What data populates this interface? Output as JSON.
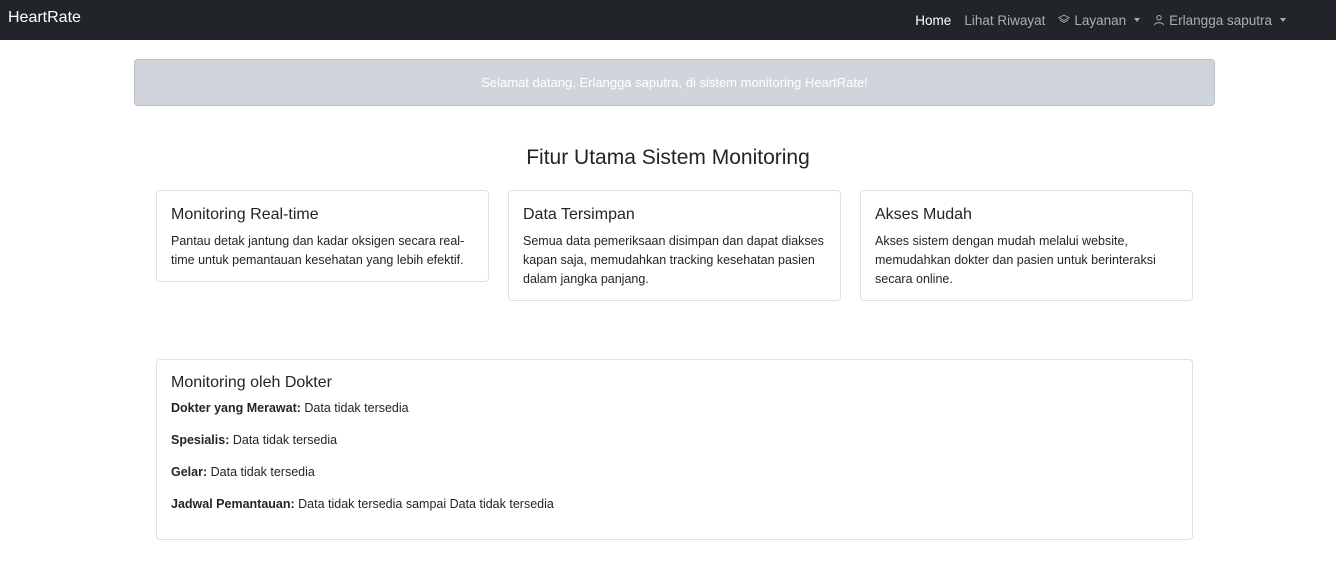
{
  "navbar": {
    "brand": "HeartRate",
    "links": [
      {
        "label": "Home",
        "active": true
      },
      {
        "label": "Lihat Riwayat",
        "active": false
      },
      {
        "label": "Layanan",
        "icon": "layers-icon",
        "dropdown": true
      },
      {
        "label": "Erlangga saputra",
        "icon": "user-icon",
        "dropdown": true
      }
    ]
  },
  "alert": {
    "message": "Selamat datang, Erlangga saputra, di sistem monitoring HeartRate!"
  },
  "features": {
    "title": "Fitur Utama Sistem Monitoring",
    "cards": [
      {
        "title": "Monitoring Real-time",
        "text": "Pantau detak jantung dan kadar oksigen secara real-time untuk pemantauan kesehatan yang lebih efektif."
      },
      {
        "title": "Data Tersimpan",
        "text": "Semua data pemeriksaan disimpan dan dapat diakses kapan saja, memudahkan tracking kesehatan pasien dalam jangka panjang."
      },
      {
        "title": "Akses Mudah",
        "text": "Akses sistem dengan mudah melalui website, memudahkan dokter dan pasien untuk berinteraksi secara online."
      }
    ]
  },
  "doctor": {
    "title": "Monitoring oleh Dokter",
    "fields": [
      {
        "label": "Dokter yang Merawat:",
        "value": "Data tidak tersedia"
      },
      {
        "label": "Spesialis:",
        "value": "Data tidak tersedia"
      },
      {
        "label": "Gelar:",
        "value": "Data tidak tersedia"
      },
      {
        "label": "Jadwal Pemantauan:",
        "value": "Data tidak tersedia sampai Data tidak tersedia"
      }
    ]
  },
  "colors": {
    "navbar_bg": "#212529",
    "alert_bg": "#d0d5dc",
    "card_border": "#dfe1e5"
  }
}
